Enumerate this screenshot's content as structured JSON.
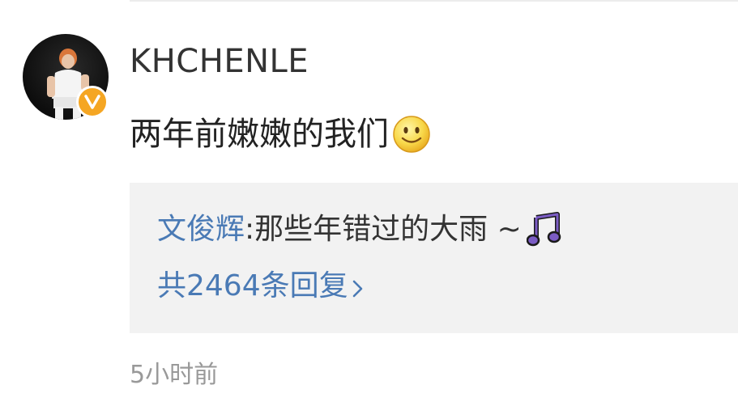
{
  "comment": {
    "username": "KHCHENLE",
    "text": "两年前嫩嫩的我们",
    "emoji_icon": "smile-icon",
    "verified": true,
    "timestamp": "5小时前"
  },
  "reply_preview": {
    "author": "文俊辉",
    "separator": ":",
    "text": "那些年错过的大雨 ~",
    "emoji_icon": "music-note-icon",
    "count_label": "共2464条回复"
  },
  "colors": {
    "link": "#4a7ab5",
    "badge": "#f5a623",
    "music_note": "#7b5cc4",
    "reply_bg": "#f2f2f2"
  }
}
